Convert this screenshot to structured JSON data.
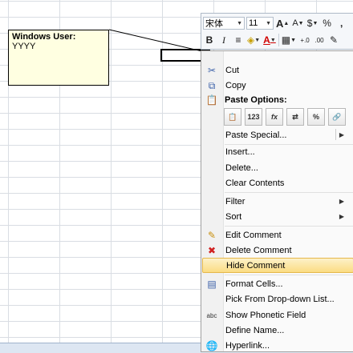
{
  "comment": {
    "author": "Windows User:",
    "text": "YYYY"
  },
  "mini_toolbar": {
    "font_name": "宋体",
    "font_size": "11",
    "grow_font": "A",
    "shrink_font": "A",
    "currency": "$",
    "percent": "%",
    "bold": "B",
    "italic": "I",
    "align": "≡",
    "fill": "◈",
    "font_color": "A",
    "borders": "▦",
    "increase_decimal": "+.0",
    "decrease_decimal": ".00",
    "format_painter": "✎"
  },
  "menu": {
    "cut": "Cut",
    "copy": "Copy",
    "paste_options": "Paste Options:",
    "paste_icons": [
      "📋",
      "123",
      "fx",
      "⇄",
      "%",
      "🔗"
    ],
    "paste_special": "Paste Special...",
    "insert": "Insert...",
    "delete": "Delete...",
    "clear_contents": "Clear Contents",
    "filter": "Filter",
    "sort": "Sort",
    "edit_comment": "Edit Comment",
    "delete_comment": "Delete Comment",
    "hide_comment": "Hide Comment",
    "format_cells": "Format Cells...",
    "pick_from_list": "Pick From Drop-down List...",
    "show_phonetic": "Show Phonetic Field",
    "define_name": "Define Name...",
    "hyperlink": "Hyperlink..."
  }
}
